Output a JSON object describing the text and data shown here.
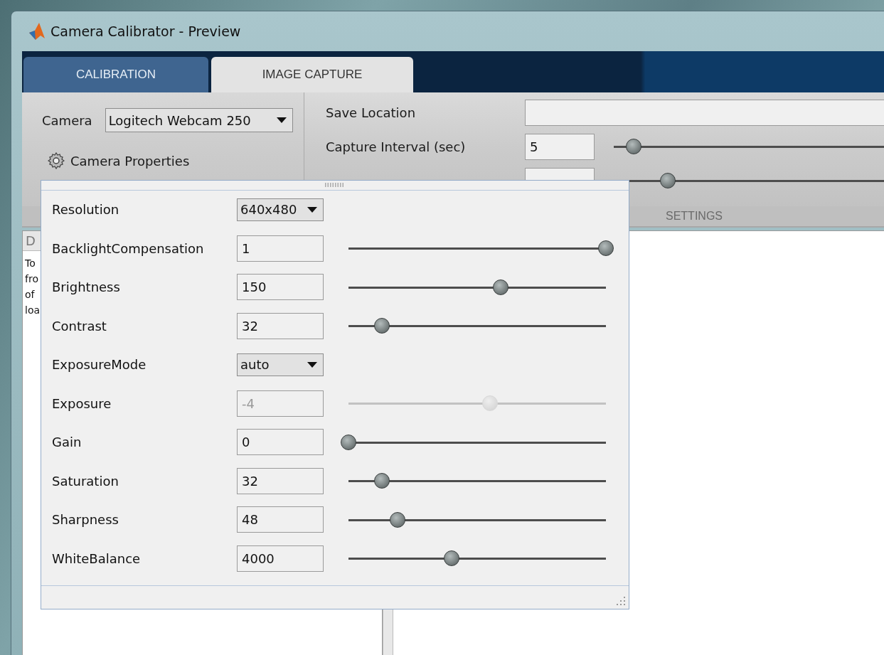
{
  "window": {
    "title": "Camera Calibrator - Preview"
  },
  "tabs": [
    {
      "label": "CALIBRATION",
      "selected": false
    },
    {
      "label": "IMAGE CAPTURE",
      "selected": true
    }
  ],
  "camera_section": {
    "camera_label": "Camera",
    "camera_select": "Logitech Webcam 250",
    "properties_button": "Camera Properties"
  },
  "settings_section": {
    "title": "SETTINGS",
    "save_location": {
      "label": "Save Location"
    },
    "capture_interval": {
      "label": "Capture Interval (sec)",
      "value": "5",
      "level": 0.07
    },
    "image_count": {
      "level": 0.19
    }
  },
  "document_panel": {
    "tab": "D",
    "lines": [
      "To",
      "fro",
      "of",
      "loa"
    ]
  },
  "camera_properties": [
    {
      "kind": "dropdown",
      "label": "Resolution",
      "value": "640x480",
      "disabled": false
    },
    {
      "kind": "slider",
      "label": "BacklightCompensation",
      "value": "1",
      "level": 1,
      "disabled": false
    },
    {
      "kind": "slider",
      "label": "Brightness",
      "value": "150",
      "level": 0.59,
      "disabled": false
    },
    {
      "kind": "slider",
      "label": "Contrast",
      "value": "32",
      "level": 0.13,
      "disabled": false
    },
    {
      "kind": "dropdown",
      "label": "ExposureMode",
      "value": "auto",
      "disabled": false
    },
    {
      "kind": "slider",
      "label": "Exposure",
      "value": "-4",
      "level": 0.55,
      "disabled": true
    },
    {
      "kind": "slider",
      "label": "Gain",
      "value": "0",
      "level": 0,
      "disabled": false
    },
    {
      "kind": "slider",
      "label": "Saturation",
      "value": "32",
      "level": 0.13,
      "disabled": false
    },
    {
      "kind": "slider",
      "label": "Sharpness",
      "value": "48",
      "level": 0.19,
      "disabled": false
    },
    {
      "kind": "slider",
      "label": "WhiteBalance",
      "value": "4000",
      "level": 0.4,
      "disabled": false
    }
  ]
}
